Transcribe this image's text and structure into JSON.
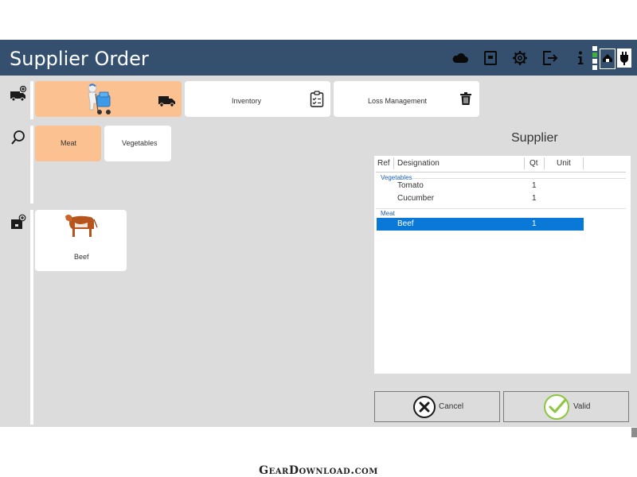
{
  "header": {
    "title": "Supplier Order",
    "icons": [
      "cloud-icon",
      "register-icon",
      "gear-icon",
      "logout-icon",
      "info-icon",
      "home-icon",
      "power-plug-icon"
    ],
    "status_colors": [
      "#ffffff",
      "#3cb043",
      "#ffffff",
      "#ffffff"
    ]
  },
  "sidebar": {
    "icons": [
      "add-delivery-icon",
      "search-icon",
      "add-product-icon"
    ]
  },
  "modules": [
    {
      "label": "",
      "icon": "delivery-truck-icon",
      "active": true
    },
    {
      "label": "Inventory",
      "icon": "clipboard-check-icon",
      "active": false
    },
    {
      "label": "Loss Management",
      "icon": "trash-icon",
      "active": false
    }
  ],
  "categories": [
    {
      "label": "Meat",
      "active": true
    },
    {
      "label": "Vegetables",
      "active": false
    }
  ],
  "products": [
    {
      "label": "Beef",
      "image": "cow-image"
    }
  ],
  "supplier": {
    "title": "Supplier",
    "columns": [
      "Ref",
      "Designation",
      "Qt",
      "Unit"
    ],
    "groups": [
      {
        "name": "Vegetables",
        "rows": [
          {
            "designation": "Tomato",
            "qt": "1",
            "unit": ""
          },
          {
            "designation": "Cucumber",
            "qt": "1",
            "unit": ""
          }
        ]
      },
      {
        "name": "Meat",
        "rows": [
          {
            "designation": "Beef",
            "qt": "1",
            "unit": "",
            "selected": true
          }
        ]
      }
    ]
  },
  "actions": {
    "cancel_label": "Cancel",
    "valid_label": "Valid"
  },
  "watermark": "GearDownload.com",
  "colors": {
    "header_bg": "#35506f",
    "accent_tile": "#fcc190",
    "selection": "#0a78d7",
    "group_label": "#1e5fb5",
    "valid_green": "#8cc63f"
  }
}
